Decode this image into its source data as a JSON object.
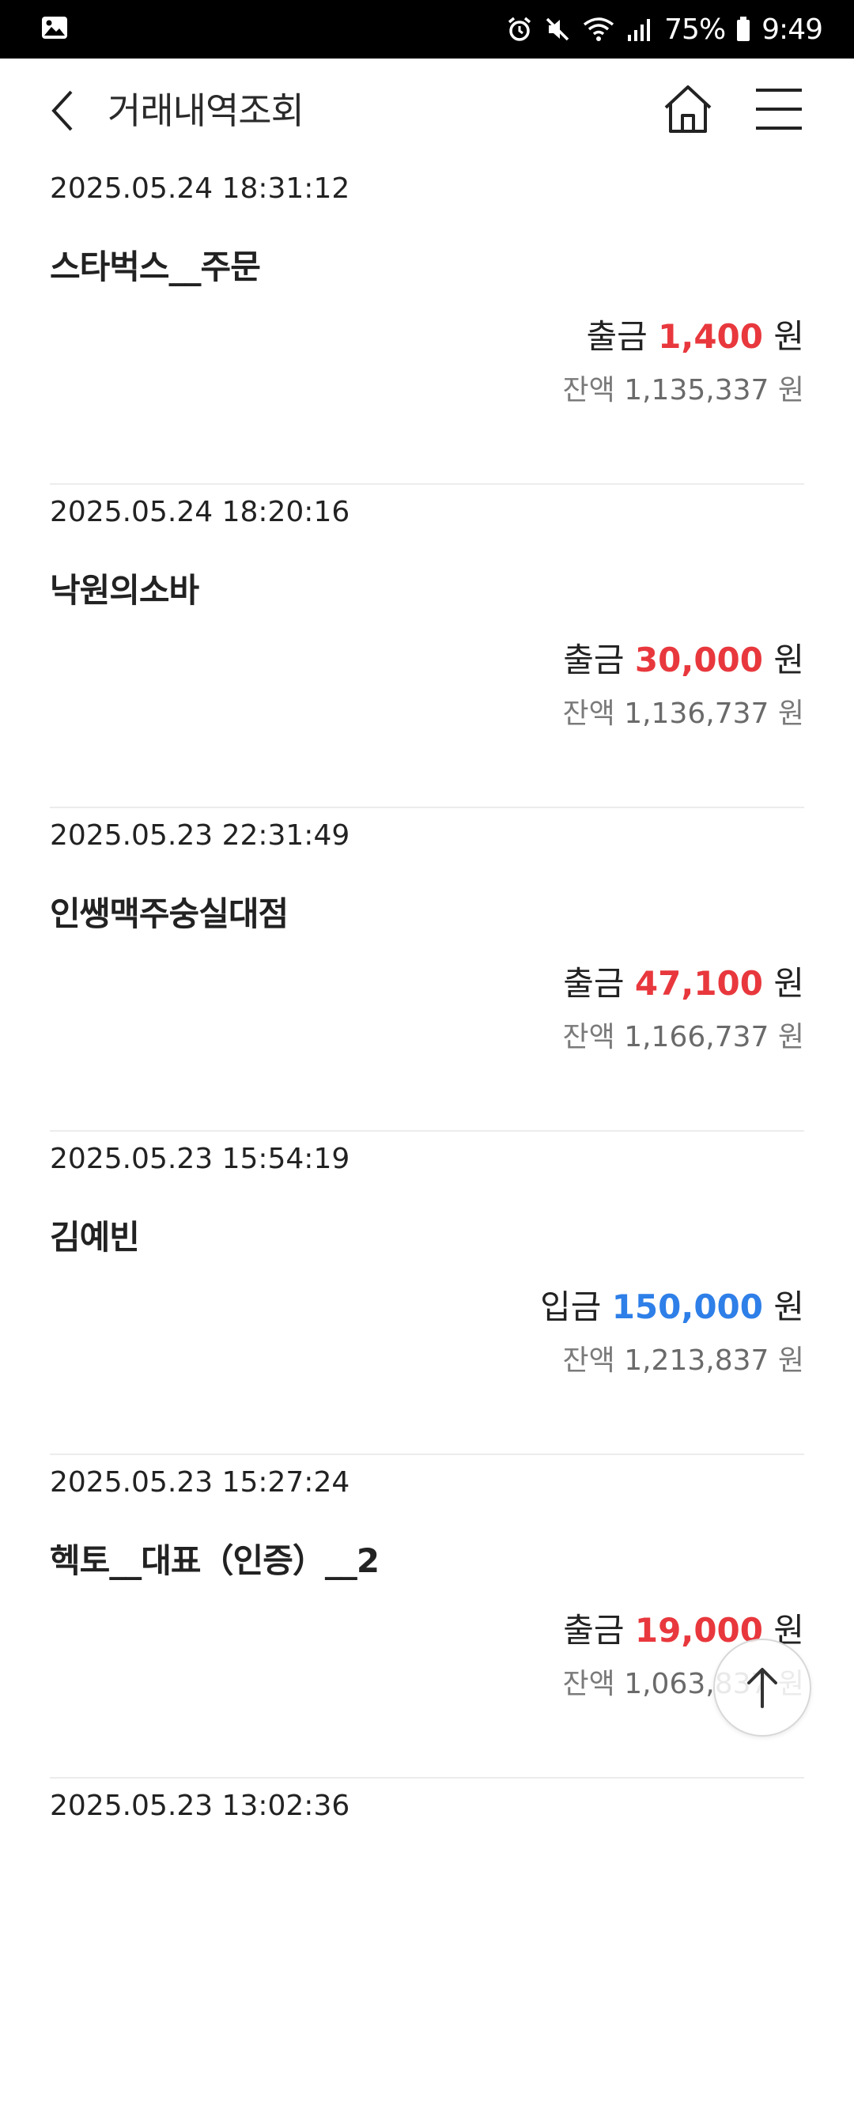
{
  "status_bar": {
    "battery": "75%",
    "time": "9:49"
  },
  "header": {
    "title": "거래내역조회"
  },
  "transactions": [
    {
      "datetime": "2025.05.24 18:31:12",
      "name": "스타벅스__주문",
      "type": "출금",
      "amount": "1,400",
      "amount_unit": "원",
      "balance_label": "잔액",
      "balance": "1,135,337",
      "balance_unit": "원"
    },
    {
      "datetime": "2025.05.24 18:20:16",
      "name": "낙원의소바",
      "type": "출금",
      "amount": "30,000",
      "amount_unit": "원",
      "balance_label": "잔액",
      "balance": "1,136,737",
      "balance_unit": "원"
    },
    {
      "datetime": "2025.05.23 22:31:49",
      "name": "인쌩맥주숭실대점",
      "type": "출금",
      "amount": "47,100",
      "amount_unit": "원",
      "balance_label": "잔액",
      "balance": "1,166,737",
      "balance_unit": "원"
    },
    {
      "datetime": "2025.05.23 15:54:19",
      "name": "김예빈",
      "type": "입금",
      "amount": "150,000",
      "amount_unit": "원",
      "balance_label": "잔액",
      "balance": "1,213,837",
      "balance_unit": "원"
    },
    {
      "datetime": "2025.05.23 15:27:24",
      "name": "헥토__대표（인증）__2",
      "type": "출금",
      "amount": "19,000",
      "amount_unit": "원",
      "balance_label": "잔액",
      "balance": "1,063,837",
      "balance_unit": "원"
    },
    {
      "datetime": "2025.05.23 13:02:36",
      "name": "",
      "type": "",
      "amount": "",
      "amount_unit": "",
      "balance_label": "",
      "balance": "",
      "balance_unit": ""
    }
  ],
  "colors": {
    "withdrawal": "#e8383d",
    "deposit": "#2e7fe8"
  },
  "icons": {
    "back": "chevron-left-icon",
    "home": "home-icon",
    "menu": "hamburger-menu-icon",
    "scroll_top": "arrow-up-icon"
  }
}
